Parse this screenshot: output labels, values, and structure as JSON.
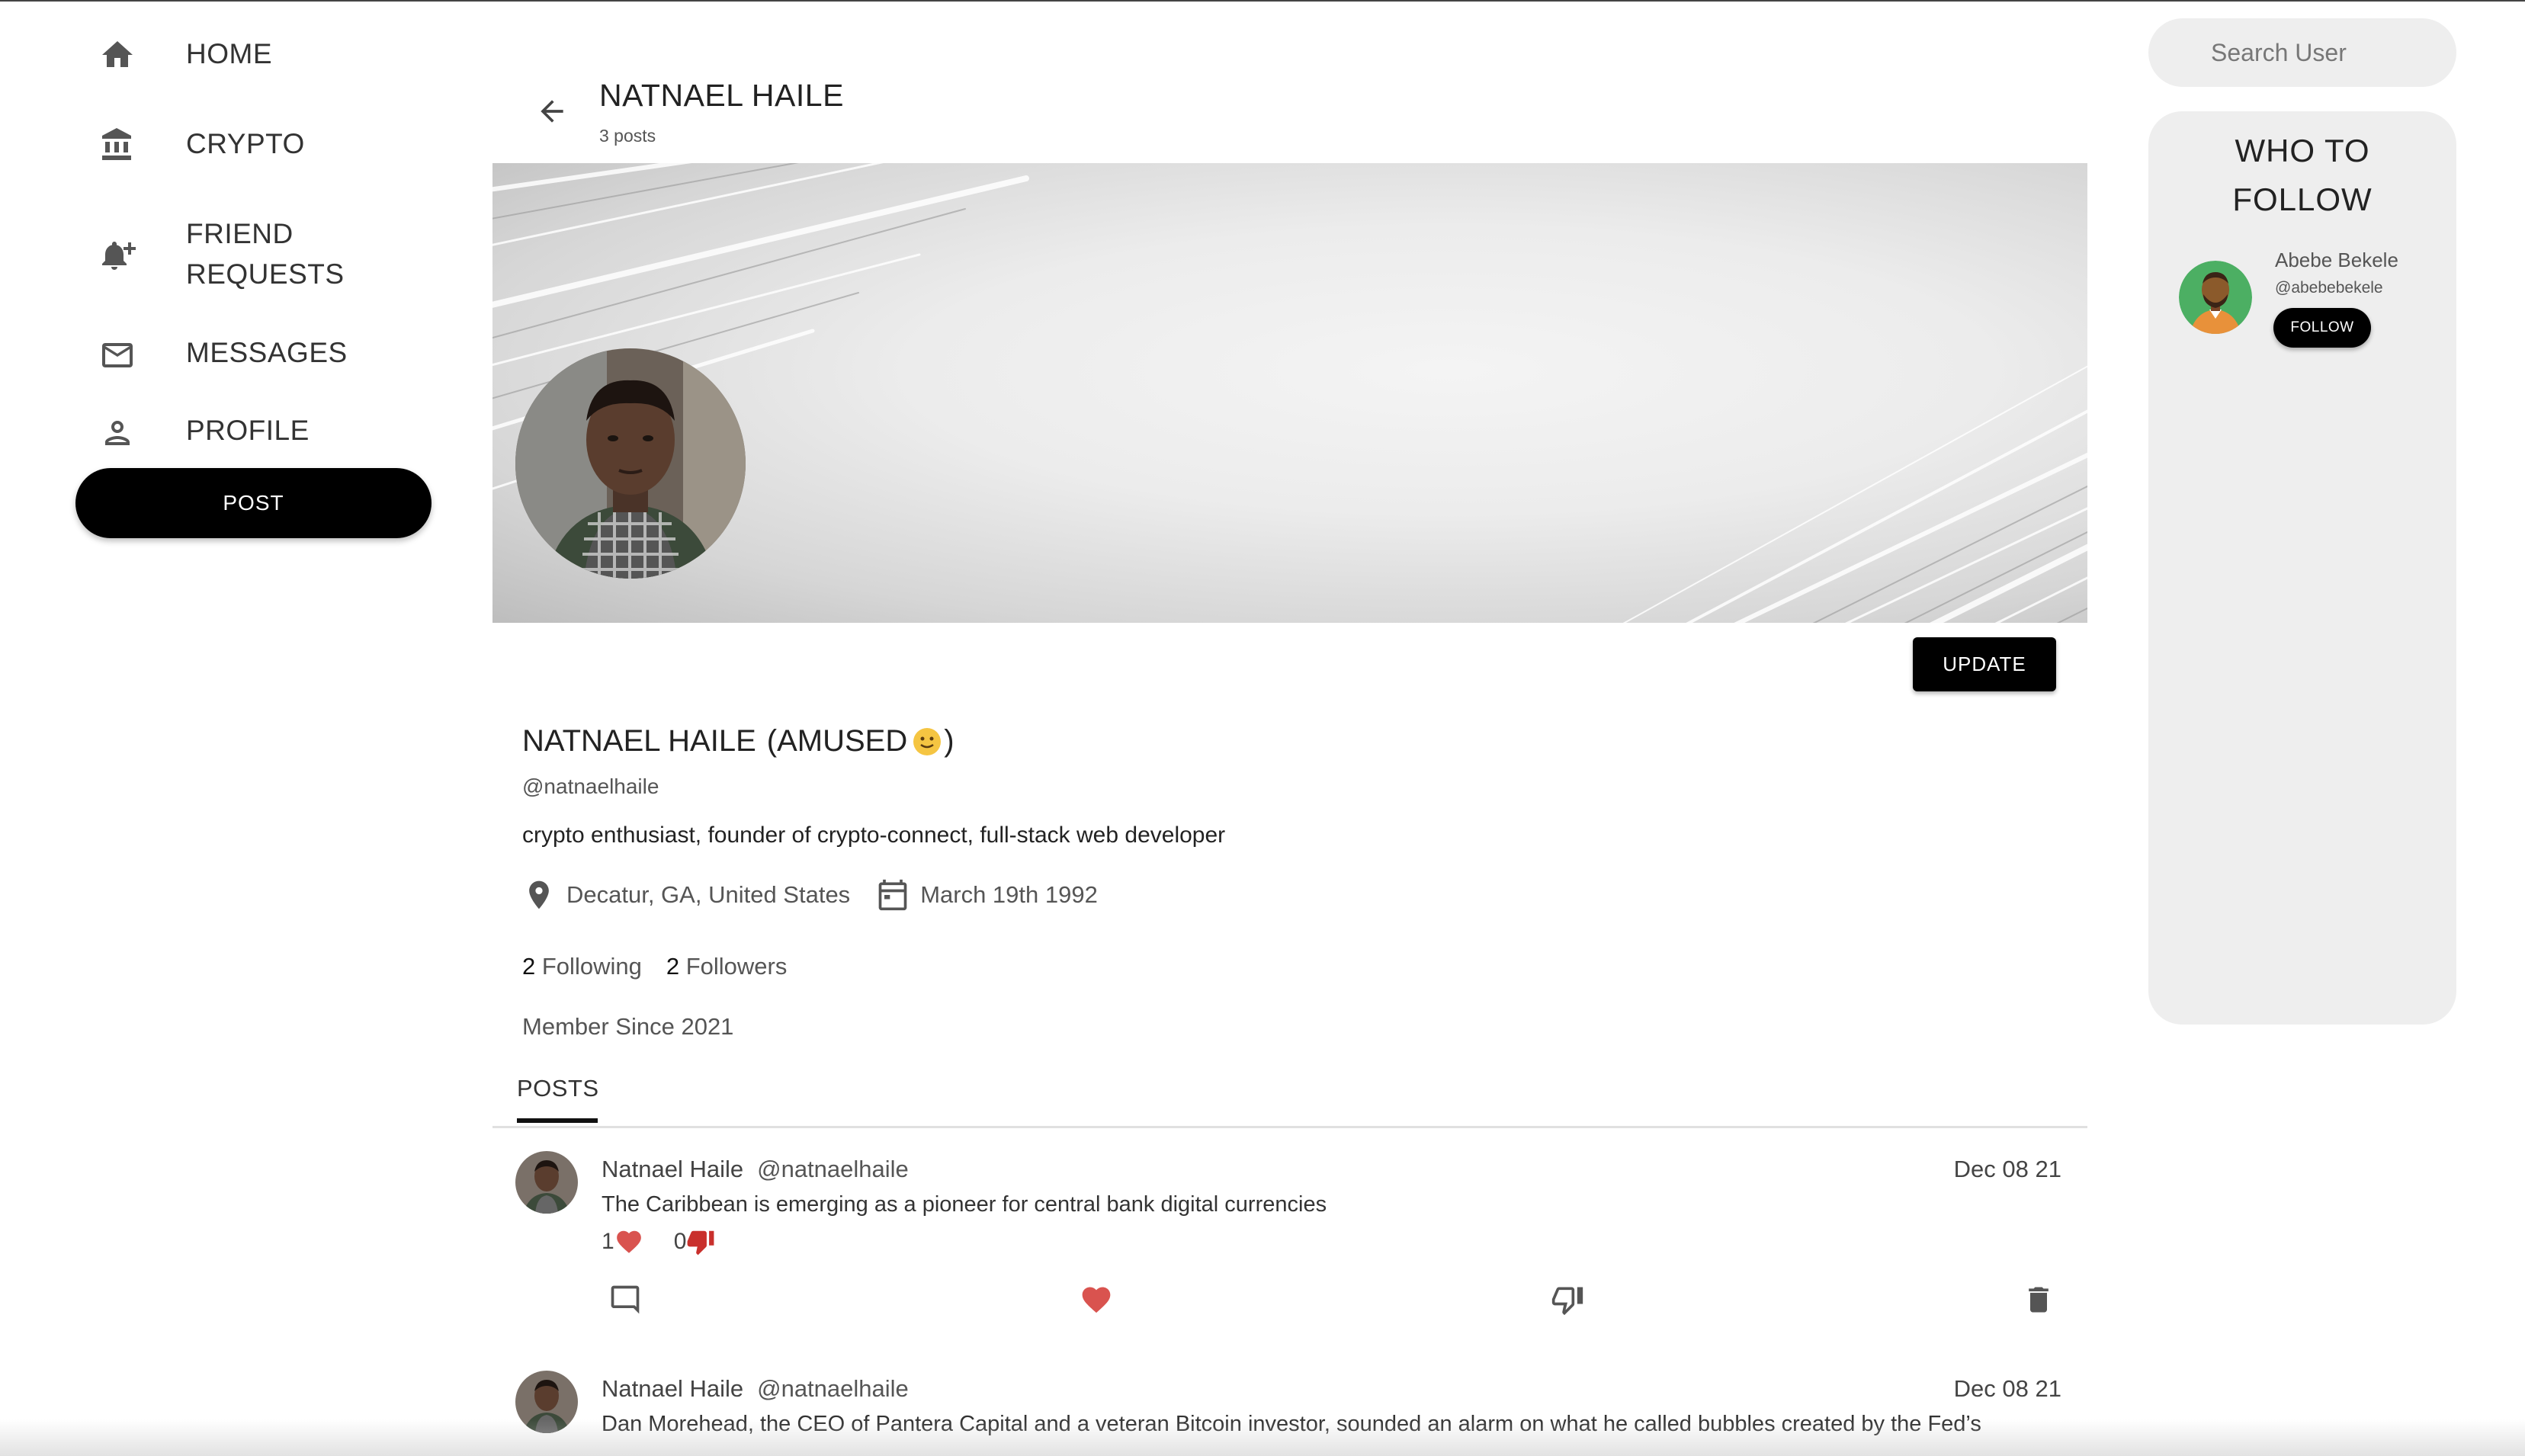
{
  "sidebar": {
    "items": [
      {
        "label": "HOME",
        "icon": "home-icon"
      },
      {
        "label": "CRYPTO",
        "icon": "bank-icon"
      },
      {
        "label": "FRIEND REQUESTS",
        "icon": "bell-plus-icon"
      },
      {
        "label": "MESSAGES",
        "icon": "mail-icon"
      },
      {
        "label": "PROFILE",
        "icon": "person-icon"
      }
    ],
    "post_label": "POST"
  },
  "header": {
    "title": "NATNAEL HAILE",
    "post_count": "3 posts"
  },
  "profile": {
    "update_label": "UPDATE",
    "name": "NATNAEL HAILE",
    "mood": "(AMUSED",
    "mood_close": ")",
    "handle": "@natnaelhaile",
    "bio": "crypto enthusiast, founder of crypto-connect, full-stack web developer",
    "location": "Decatur, GA, United States",
    "birthday": "March 19th 1992",
    "following_count": "2",
    "following_label": "Following",
    "followers_count": "2",
    "followers_label": "Followers",
    "member_since": "Member Since 2021"
  },
  "tabs": {
    "posts": "POSTS"
  },
  "posts": [
    {
      "author": "Natnael Haile",
      "handle": "@natnaelhaile",
      "date": "Dec 08 21",
      "text": "The Caribbean is emerging as a pioneer for central bank digital currencies",
      "likes": "1",
      "dislikes": "0"
    },
    {
      "author": "Natnael Haile",
      "handle": "@natnaelhaile",
      "date": "Dec 08 21",
      "text": "Dan Morehead, the CEO of Pantera Capital and a veteran Bitcoin investor, sounded an alarm on what he called bubbles created by the Fed’s"
    }
  ],
  "search": {
    "placeholder": "Search User"
  },
  "who_to_follow": {
    "title_line1": "WHO TO",
    "title_line2": "FOLLOW",
    "user_name": "Abebe Bekele",
    "user_handle": "@abebebekele",
    "follow_label": "FOLLOW"
  },
  "colors": {
    "accent": "#000000",
    "like": "#d9534f",
    "dislike": "#c9302c",
    "panel_bg": "#eeeeee",
    "icon_gray": "#555555"
  }
}
